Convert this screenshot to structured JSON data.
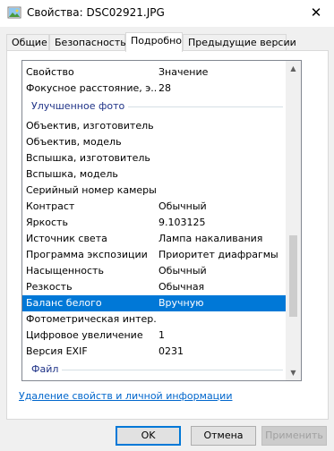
{
  "window": {
    "title": "Свойства: DSC02921.JPG",
    "close_glyph": "✕"
  },
  "tabs": [
    {
      "label": "Общие"
    },
    {
      "label": "Безопасность"
    },
    {
      "label": "Подробно",
      "active": true
    },
    {
      "label": "Предыдущие версии"
    }
  ],
  "list": {
    "header": {
      "name": "Свойство",
      "value": "Значение"
    },
    "rows_top": [
      {
        "name": "Фокусное расстояние, э...",
        "value": "28"
      }
    ],
    "group1": "Улучшенное фото",
    "rows": [
      {
        "name": "Объектив, изготовитель",
        "value": ""
      },
      {
        "name": "Объектив, модель",
        "value": ""
      },
      {
        "name": "Вспышка, изготовитель",
        "value": ""
      },
      {
        "name": "Вспышка, модель",
        "value": ""
      },
      {
        "name": "Серийный номер камеры",
        "value": ""
      },
      {
        "name": "Контраст",
        "value": "Обычный"
      },
      {
        "name": "Яркость",
        "value": "9.103125"
      },
      {
        "name": "Источник света",
        "value": "Лампа накаливания"
      },
      {
        "name": "Программа экспозиции",
        "value": "Приоритет диафрагмы"
      },
      {
        "name": "Насыщенность",
        "value": "Обычный"
      },
      {
        "name": "Резкость",
        "value": "Обычная"
      },
      {
        "name": "Баланс белого",
        "value": "Вручную",
        "selected": true
      },
      {
        "name": "Фотометрическая интер...",
        "value": ""
      },
      {
        "name": "Цифровое увеличение",
        "value": "1"
      },
      {
        "name": "Версия EXIF",
        "value": "0231"
      }
    ],
    "group2": "Файл",
    "scroll_up_glyph": "▲",
    "scroll_down_glyph": "▼"
  },
  "remove_link": "Удаление свойств и личной информации",
  "buttons": {
    "ok": "OK",
    "cancel": "Отмена",
    "apply": "Применить"
  },
  "colors": {
    "selection": "#0078d7",
    "group_header": "#1e3287",
    "link": "#0066cc"
  }
}
